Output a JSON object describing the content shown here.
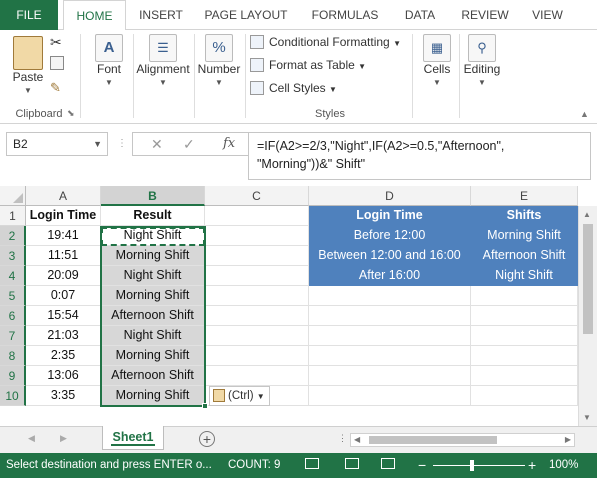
{
  "ribbon_tabs": [
    "FILE",
    "HOME",
    "INSERT",
    "PAGE LAYOUT",
    "FORMULAS",
    "DATA",
    "REVIEW",
    "VIEW"
  ],
  "active_tab": "HOME",
  "ribbon": {
    "paste_label": "Paste",
    "clipboard_label": "Clipboard",
    "font_label": "Font",
    "alignment_label": "Alignment",
    "number_label": "Number",
    "conditional_formatting": "Conditional Formatting",
    "format_as_table": "Format as Table",
    "cell_styles": "Cell Styles",
    "styles_label": "Styles",
    "cells_label": "Cells",
    "editing_label": "Editing",
    "number_icon": "%"
  },
  "formula_bar": {
    "name_box": "B2",
    "cancel_icon": "✕",
    "enter_icon": "✓",
    "fx_label": "fx",
    "formula": "=IF(A2>=2/3,\"Night\",IF(A2>=0.5,\"Afternoon\",\n\"Morning\"))&\" Shift\""
  },
  "columns": [
    "A",
    "B",
    "C",
    "D",
    "E"
  ],
  "rows": [
    "1",
    "2",
    "3",
    "4",
    "5",
    "6",
    "7",
    "8",
    "9",
    "10"
  ],
  "table": {
    "col_a_header": "Login Time",
    "col_b_header": "Result",
    "login_times": [
      "19:41",
      "11:51",
      "20:09",
      "0:07",
      "15:54",
      "21:03",
      "2:35",
      "13:06",
      "3:35"
    ],
    "results": [
      "Night Shift",
      "Morning Shift",
      "Night Shift",
      "Morning Shift",
      "Afternoon Shift",
      "Night Shift",
      "Morning Shift",
      "Afternoon Shift",
      "Morning Shift"
    ]
  },
  "lookup": {
    "header_time": "Login Time",
    "header_shift": "Shifts",
    "times": [
      "Before 12:00",
      "Between 12:00 and 16:00",
      "After 16:00"
    ],
    "shifts": [
      "Morning Shift",
      "Afternoon Shift",
      "Night Shift"
    ]
  },
  "paste_options_label": "(Ctrl)",
  "sheet_tab": "Sheet1",
  "status": {
    "message": "Select destination and press ENTER o...",
    "count": "COUNT: 9",
    "zoom": "100%",
    "minus": "−",
    "plus": "+"
  },
  "colors": {
    "accent": "#217346",
    "lookup_fill": "#4f81bd",
    "selection_fill": "#d7d7d7"
  }
}
